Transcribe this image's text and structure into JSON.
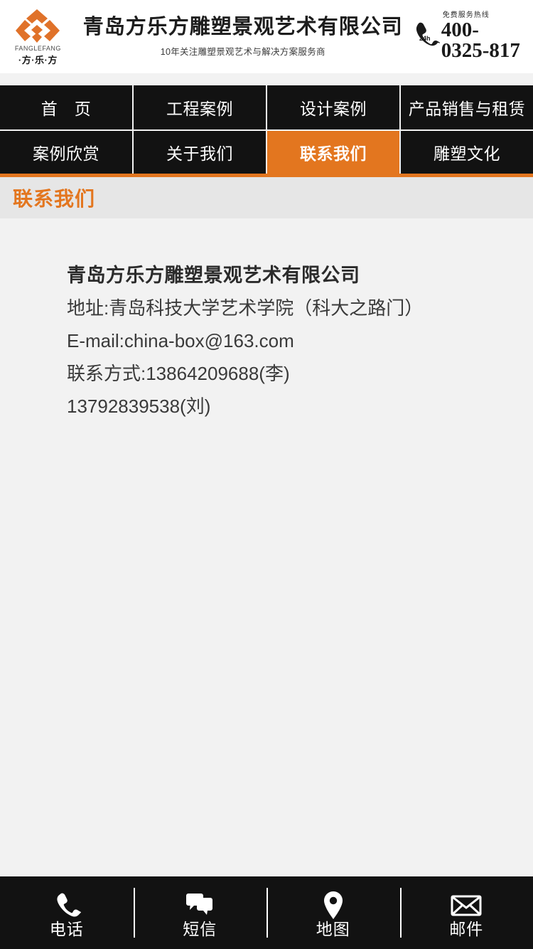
{
  "theme": {
    "accent": "#e3761f",
    "nav_bg": "#121212",
    "page_bg": "#f2f2f2",
    "title_band_bg": "#e6e6e6",
    "text_dark": "#2b2b2b"
  },
  "header": {
    "logo": {
      "icon": "fanglefang-diamond-logo",
      "english": "FANGLEFANG",
      "chinese": "·方·乐·方"
    },
    "company_name": "青岛方乐方雕塑景观艺术有限公司",
    "slogan": "10年关注雕塑景观艺术与解决方案服务商",
    "hotline": {
      "icon": "phone-handset-icon",
      "badge": "24h",
      "label": "免费服务热线",
      "number": "400-0325-817"
    }
  },
  "nav": {
    "rows": [
      [
        {
          "label": "首　页",
          "active": false
        },
        {
          "label": "工程案例",
          "active": false
        },
        {
          "label": "设计案例",
          "active": false
        },
        {
          "label": "产品销售与租赁",
          "active": false
        }
      ],
      [
        {
          "label": "案例欣赏",
          "active": false
        },
        {
          "label": "关于我们",
          "active": false
        },
        {
          "label": "联系我们",
          "active": true
        },
        {
          "label": "雕塑文化",
          "active": false
        }
      ]
    ]
  },
  "page_title": "联系我们",
  "contact": {
    "company": "青岛方乐方雕塑景观艺术有限公司",
    "lines": [
      "地址:青岛科技大学艺术学院（科大之路门）",
      "E-mail:china-box@163.com",
      "联系方式:13864209688(李)",
      "13792839538(刘)"
    ]
  },
  "bottom_bar": {
    "items": [
      {
        "label": "电话",
        "icon": "phone-icon"
      },
      {
        "label": "短信",
        "icon": "message-bubbles-icon"
      },
      {
        "label": "地图",
        "icon": "map-pin-icon"
      },
      {
        "label": "邮件",
        "icon": "envelope-icon"
      }
    ]
  }
}
